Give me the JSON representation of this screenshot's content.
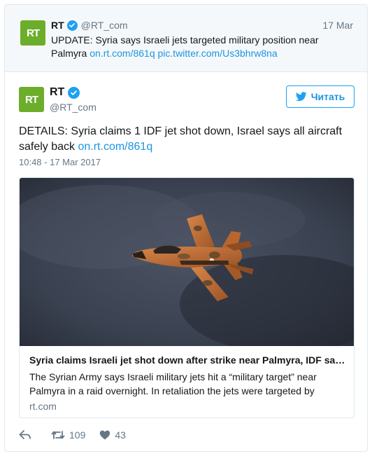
{
  "colors": {
    "brand_green": "#6cae2c",
    "link_blue": "#1b95e0",
    "verified_blue": "#1da1f2",
    "muted_gray": "#657786"
  },
  "parent_tweet": {
    "logo_text": "RT",
    "name": "RT",
    "verified_icon": "verified-badge-icon",
    "handle": "@RT_com",
    "date": "17 Mar",
    "text": "UPDATE: Syria says Israeli jets targeted military position near Palmyra ",
    "link1": "on.rt.com/861q",
    "link2": "pic.twitter.com/Us3bhrw8na"
  },
  "tweet": {
    "logo_text": "RT",
    "name": "RT",
    "handle": "@RT_com",
    "follow_icon": "twitter-bird-icon",
    "follow_label": "Читать",
    "text": "DETAILS: Syria claims 1 IDF jet shot down, Israel says all aircraft safely back ",
    "link": "on.rt.com/861q",
    "timestamp": "10:48 - 17 Mar 2017"
  },
  "card": {
    "image_alt": "fighter-jet-photo",
    "title": "Syria claims Israeli jet shot down after strike near Palmyra, IDF says all aircraft safely back",
    "description": "The Syrian Army says Israeli military jets hit a “military target” near Palmyra in a raid overnight. In retaliation the jets were targeted by",
    "domain": "rt.com"
  },
  "actions": {
    "reply_icon": "reply-icon",
    "retweet_icon": "retweet-icon",
    "retweet_count": "109",
    "like_icon": "heart-icon",
    "like_count": "43"
  }
}
